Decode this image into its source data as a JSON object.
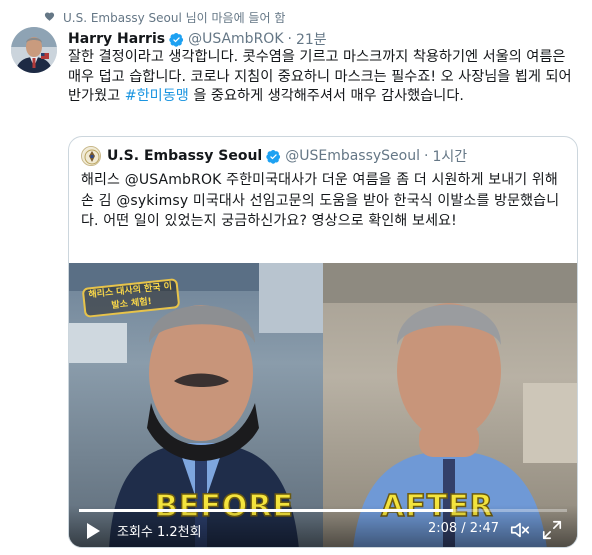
{
  "social_context": {
    "text": "U.S. Embassy Seoul 님이 마음에 들어 함",
    "icon": "heart-icon"
  },
  "tweet": {
    "author_name": "Harry Harris",
    "handle": "@USAmbROK",
    "separator": "·",
    "time": "21분",
    "text_part1": "잘한 결정이라고 생각합니다. 콧수염을 기르고 마스크까지 착용하기엔 서울의 여름은 매우 덥고 습합니다. 코로나 지침이 중요하니 마스크는 필수죠! 오 사장님을 뵙게 되어 반가웠고 ",
    "hashtag": "#한미동맹",
    "text_part2": " 을 중요하게 생각해주셔서 매우 감사했습니다."
  },
  "quoted": {
    "author_name": "U.S. Embassy Seoul",
    "handle": "@USEmbassySeoul",
    "separator": "·",
    "time": "1시간",
    "text": "해리스 @USAmbROK 주한미국대사가 더운 여름을 좀 더 시원하게 보내기 위해 손 김 @sykimsy 미국대사 선임고문의 도움을 받아 한국식 이발소를 방문했습니다. 어떤 일이 있었는지 궁금하신가요? 영상으로 확인해 보세요!",
    "video": {
      "overlay_caption": "해리스 대사의 한국 이발소 체험!",
      "label_before": "BEFORE",
      "label_after": "AFTER",
      "views": "조회수 1.2천회",
      "timer": "2:08 / 2:47",
      "progress": 0.766
    }
  },
  "colors": {
    "link": "#1b95e0",
    "verified": "#1da1f2",
    "muted": "#657786",
    "border": "#ccd6dd"
  }
}
